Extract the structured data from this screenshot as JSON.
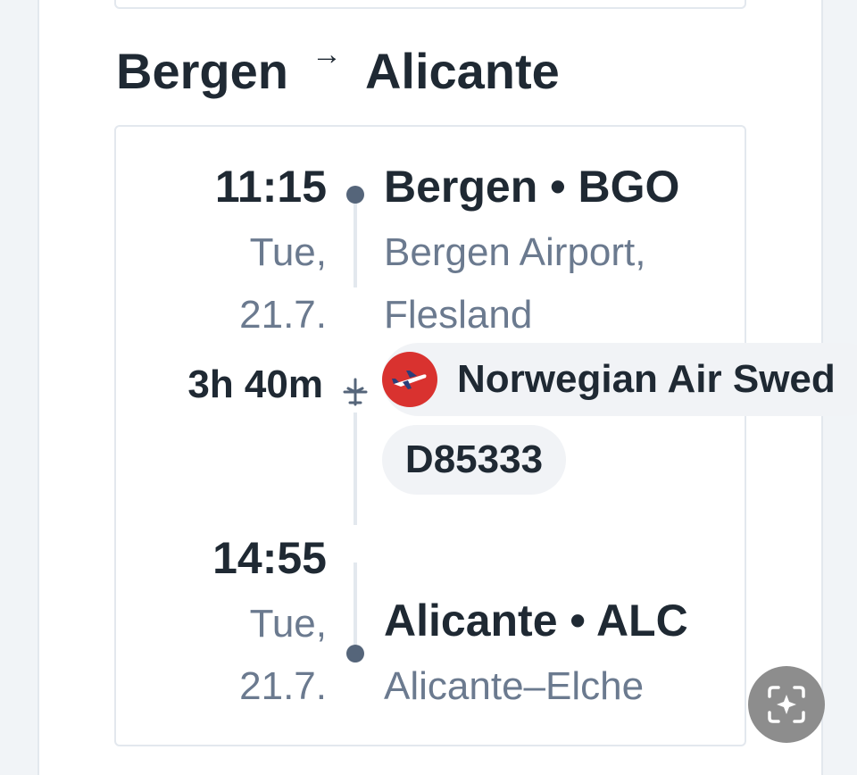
{
  "route": {
    "origin": "Bergen",
    "arrow": "→",
    "destination": "Alicante"
  },
  "departure": {
    "time": "11:15",
    "date_line1": "Tue,",
    "date_line2": "21.7.",
    "place": "Bergen • BGO",
    "airport_line1": "Bergen Airport,",
    "airport_line2": "Flesland"
  },
  "flight": {
    "duration": "3h 40m",
    "airline": "Norwegian Air Swed",
    "flight_number": "D85333"
  },
  "arrival": {
    "time": "14:55",
    "date_line1": "Tue,",
    "date_line2": "21.7.",
    "place": "Alicante • ALC",
    "airport_line1": "Alicante–Elche"
  },
  "colors": {
    "text": "#1f2933",
    "muted": "#6b7a8f",
    "airline_red": "#d9322f",
    "timeline": "#55657a"
  }
}
